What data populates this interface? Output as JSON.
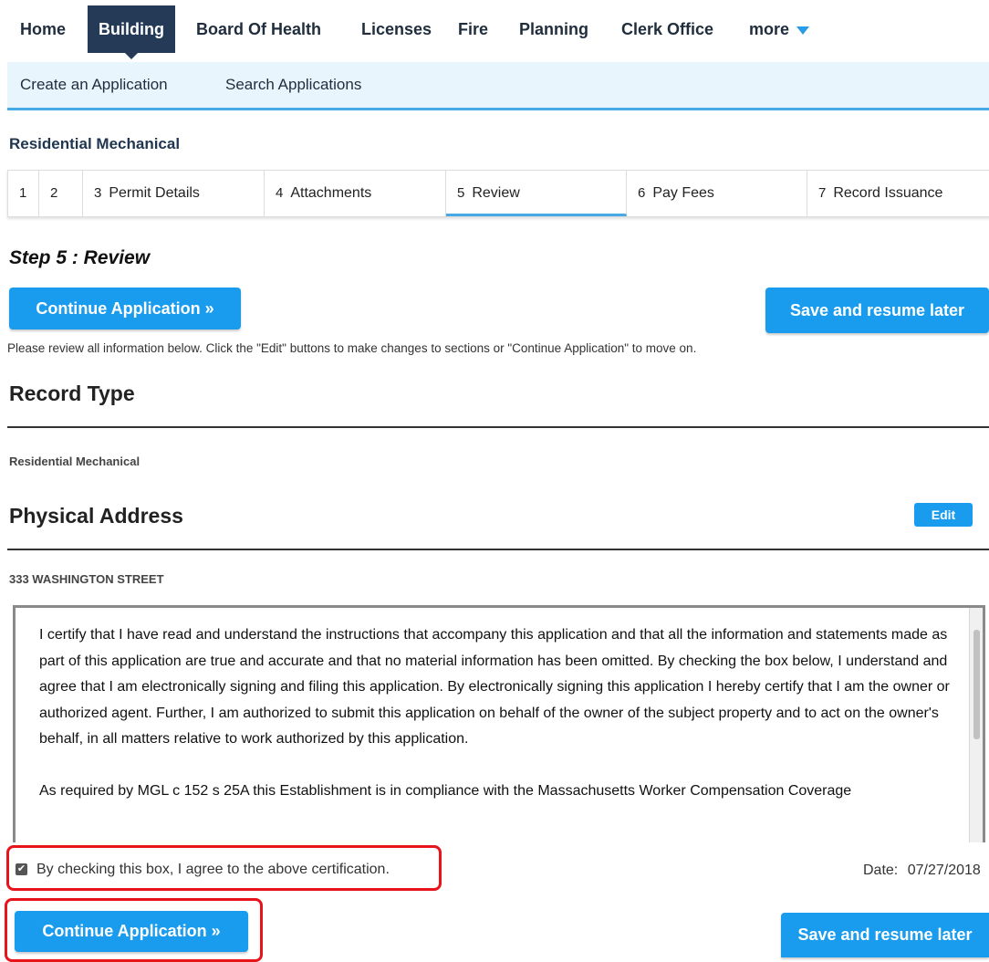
{
  "nav": {
    "tabs": [
      "Home",
      "Building",
      "Board Of Health",
      "Licenses",
      "Fire",
      "Planning",
      "Clerk Office",
      "more"
    ],
    "active_tab": "Building"
  },
  "subnav": {
    "create": "Create an Application",
    "search": "Search Applications"
  },
  "record_title": "Residential Mechanical",
  "steps": [
    {
      "num": "1",
      "label": ""
    },
    {
      "num": "2",
      "label": ""
    },
    {
      "num": "3",
      "label": "Permit Details"
    },
    {
      "num": "4",
      "label": "Attachments"
    },
    {
      "num": "5",
      "label": "Review"
    },
    {
      "num": "6",
      "label": "Pay Fees"
    },
    {
      "num": "7",
      "label": "Record Issuance"
    }
  ],
  "active_step": "5",
  "step_heading": "Step 5 : Review",
  "buttons": {
    "continue": "Continue Application »",
    "save": "Save and resume later",
    "edit": "Edit"
  },
  "instructions": "Please review all information below. Click the \"Edit\" buttons to make changes to sections or \"Continue Application\" to move on.",
  "sections": {
    "record_type": {
      "title": "Record Type",
      "value": "Residential Mechanical"
    },
    "physical_address": {
      "title": "Physical Address",
      "value": "333 WASHINGTON STREET"
    }
  },
  "certification": {
    "paragraph1": "I certify that I have read and understand the instructions that accompany this application and that all the information and statements made as part of this application are true and accurate and that no material information has been omitted. By checking the box below, I understand and agree that I am electronically signing and filing this application. By electronically signing this application I hereby certify  that I am the owner or authorized agent. Further, I am authorized to submit this application on behalf of the owner of the subject property and to act on the owner's behalf, in all matters relative to work authorized by this application.",
    "paragraph2": "As required by MGL c 152 s 25A this Establishment is in compliance with the Massachusetts Worker Compensation Coverage",
    "checkbox_label": "By checking this box, I agree to the above certification.",
    "checked": true,
    "date_label": "Date:",
    "date_value": "07/27/2018"
  },
  "colors": {
    "accent": "#1a9cee",
    "nav_active": "#243a57",
    "highlight": "#e8141b"
  }
}
